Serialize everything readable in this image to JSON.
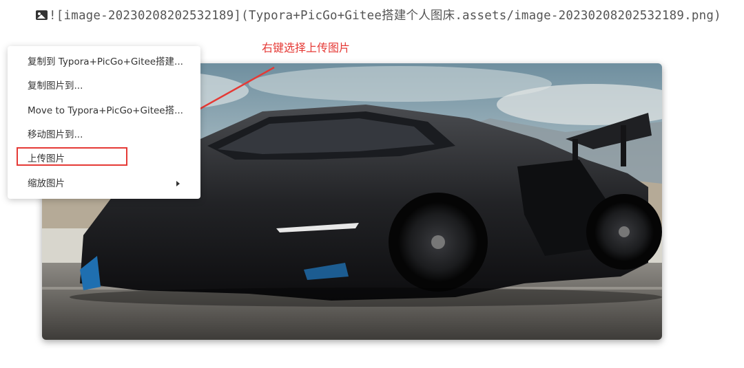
{
  "editor": {
    "markdown_source": "![image-20230208202532189](Typora+PicGo+Gitee搭建个人图床.assets/image-20230208202532189.png)",
    "image_icon": "image-icon"
  },
  "annotation": {
    "text": "右键选择上传图片",
    "color": "#e53935"
  },
  "image": {
    "subject": "black sports car photo"
  },
  "context_menu": {
    "items": [
      {
        "label": "复制到 Typora+PicGo+Gitee搭建...",
        "has_submenu": false
      },
      {
        "label": "复制图片到...",
        "has_submenu": false
      },
      {
        "label": "Move to Typora+PicGo+Gitee搭...",
        "has_submenu": false
      },
      {
        "label": "移动图片到...",
        "has_submenu": false
      },
      {
        "label": "上传图片",
        "has_submenu": false,
        "highlighted": true
      },
      {
        "label": "缩放图片",
        "has_submenu": true
      }
    ]
  }
}
